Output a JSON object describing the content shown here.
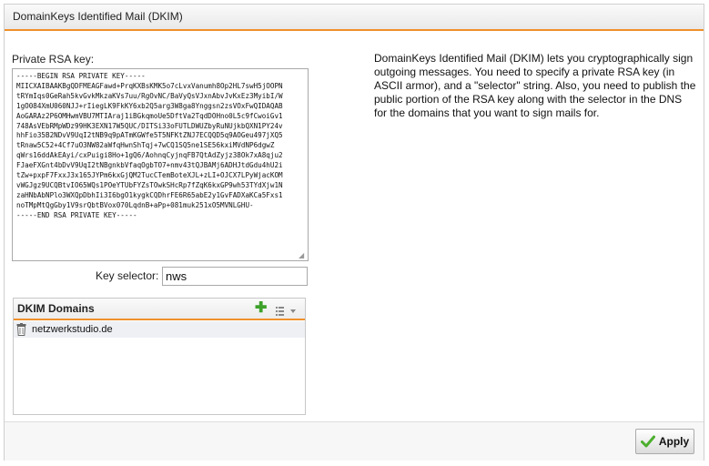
{
  "panel": {
    "title": "DomainKeys Identified Mail (DKIM)"
  },
  "rsa": {
    "label": "Private RSA key:",
    "value": "-----BEGIN RSA PRIVATE KEY-----\nMIICXAIBAAKBgQDFMEAGFawd+PrqKXBsKMK5o7cLvxVanumh8Op2HL7swH5jOOPN\ntRYmIqs0GeRah5kvGvkMkzaKVs7uu/RgOvNC/BaVyQsVJxnAbvJvKxEz3MyibI/W\n1gO084XmU060NJJ+rIiegLK9FkKY6xb2Q5arg3W8ga8Ynggsn2zsVOxFwQIDAQAB\nAoGARAz2P6OMHwmVBU7MTIAraj1iBGkqmoUe5DftVa2TqdDOHno0L5c9fCwoiGv1\n748AsVEbRMpWDz99HK3EXN17W5QUC/DITSi33oFUTLDWUZbyRuNUjkbQXN1PY24v\nhhFio35B2NDvV9UqI2tNB9q9pATmKGWfe5T5NFKtZNJ7ECQQD5q9AOGeu497jXQ5\ntRnaw5C52+4Cf7uO3NW82aWfqHwnShTqj+7wCQ1SQ5ne1SE56kxiMVdNP6dgwZ\nqWrs16ddAkEAyi/cxPuigi8Ho+1gQ6/AohnqCyjnqFB7QtAdZyjz38Ok7xA8qju2\nFJaeFXGnt4bDvV9UqI2tNBgnkbVfaqOgbTO7+nmv43tQJBAMj6ADHJtdGdu4hU2i\ntZw+pxpF7FxxJ3x165JYPm6kxGjQM2TucCTemBoteXJL+zLI+OJCX7LPyWjacKOM\nvWGJgz9UCQBtvIO65WQs1POeYTUbFYZsTOwkSHcRp7fZqK6kxGP9wh53TYdXjw1N\nzaHNbAbNPlo3WXQpDbhIi3I6bgO1kygkCQDhrFE6R65abE2y1GvFADXaKCa5Fxs1\nnoTMpMtQgGby1V9srQbtBVox070LqdnB+aPp+081muk251xO5MVNLGHU-\n-----END RSA PRIVATE KEY-----"
  },
  "selector": {
    "label": "Key selector:",
    "value": "nws"
  },
  "domains": {
    "title": "DKIM Domains",
    "add_symbol": "✚",
    "items": [
      {
        "name": "netzwerkstudio.de",
        "icon": "trash-icon"
      }
    ]
  },
  "description": "DomainKeys Identified Mail (DKIM) lets you cryptographically sign outgoing messages. You need to specify a private RSA key (in ASCII armor), and a \"selector\" string. Also, you need to publish the public portion of the RSA key along with the selector in the DNS for the domains that you want to sign mails for.",
  "apply": {
    "label": "Apply",
    "icon": "checkmark-icon"
  },
  "colors": {
    "accent": "#f0902a",
    "add_green": "#3da12a",
    "check_green": "#4caf2e"
  }
}
